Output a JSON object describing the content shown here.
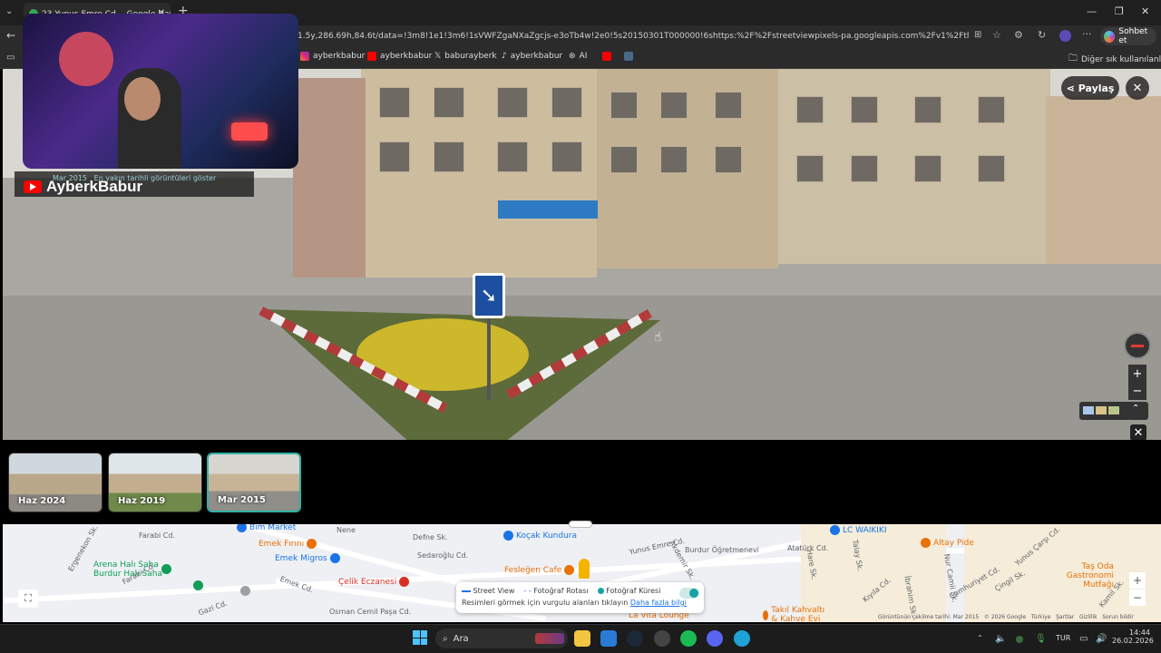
{
  "browser": {
    "tab_title": "23 Yunus Emre Cd. - Google Harit",
    "url": "1.5y,286.69h,84.6t/data=!3m8!1e1!3m6!1sVWFZgaNXaZgcjs-e3oTb4w!2e0!5s20150301T000000!6shttps:%2F%2Fstreetviewpixels-pa.googleapis.com%2Fv1%2Fthumbnail%3Fcb_cli...",
    "chat_label": "Sohbet et",
    "bookmarks": [
      "ayberkbabur",
      "ayberkbabur",
      "baburayberk",
      "ayberkbabur",
      "AI"
    ],
    "other_bookmarks": "Diğer sık kullanılanlar"
  },
  "streetview": {
    "share_label": "Paylaş",
    "date_hint_date": "Mar 2015",
    "date_hint_text": "En yakın tarihli görüntüleri göster"
  },
  "timeline": [
    {
      "label": "Haz 2024",
      "selected": false
    },
    {
      "label": "Haz 2019",
      "selected": false
    },
    {
      "label": "Mar 2015",
      "selected": true
    }
  ],
  "map": {
    "labels": [
      "Ergenekon Sk.",
      "Farabi Cd.",
      "Nene",
      "Defne Sk.",
      "Sedaroğlu Cd.",
      "Yunus Emre Cd.",
      "Akdemir Sk.",
      "Burdur Öğretmenevi",
      "Atatürk Cd.",
      "Hare Sk.",
      "Talay Sk.",
      "Yunus Çarşı Cd.",
      "Nur Camii Sk.",
      "Kıyıla Cd.",
      "Çingil Sk.",
      "Cumhuriyet Cd.",
      "İbrahim Sk.",
      "Kamil Sk.",
      "Gazi Cd.",
      "Osman Cemil Paşa Cd.",
      "Emek Cd.",
      "Farabi Cd."
    ],
    "pois": [
      {
        "name": "Bim Market",
        "color": "#1a73e8"
      },
      {
        "name": "Emek Fırını",
        "color": "#e8710a"
      },
      {
        "name": "Emek Migros",
        "color": "#1a73e8"
      },
      {
        "name": "Arena Halı Saha Burdur Halı Saha",
        "color": "#0f9d58"
      },
      {
        "name": "Koçak Kundura",
        "color": "#1a73e8"
      },
      {
        "name": "Çelik Eczanesi",
        "color": "#d93025"
      },
      {
        "name": "Fesleğen Cafe",
        "color": "#e8710a"
      },
      {
        "name": "LC WAIKIKI",
        "color": "#1a73e8"
      },
      {
        "name": "Altay Pide",
        "color": "#e8710a"
      },
      {
        "name": "Taş Oda Gastronomi Mutfağı",
        "color": "#e8710a"
      },
      {
        "name": "Takıl Kahvaltı & Kahve Evi",
        "color": "#e8710a"
      },
      {
        "name": "La Vita Lounge",
        "color": "#e8710a"
      }
    ],
    "legend": {
      "street_view": "Street View",
      "photo_route": "Fotoğraf Rotası",
      "photo_sphere": "Fotoğraf Küresi",
      "hint": "Resimleri görmek için vurgulu alanları tıklayın",
      "more_info": "Daha fazla bilgi"
    },
    "footer": [
      "Görüntünün çekilme tarihi: Mar 2015",
      "© 2026 Google",
      "Türkiye",
      "Şartlar",
      "Gizlilik",
      "Sorun bildir"
    ]
  },
  "taskbar": {
    "search_label": "Ara",
    "lang": "TUR",
    "time": "14:44",
    "date": "26.02.2026"
  },
  "overlay": {
    "channel_name": "AyberkBabur"
  },
  "colors": {
    "accent_teal": "#2bb3a8",
    "youtube_red": "#ff0000"
  }
}
